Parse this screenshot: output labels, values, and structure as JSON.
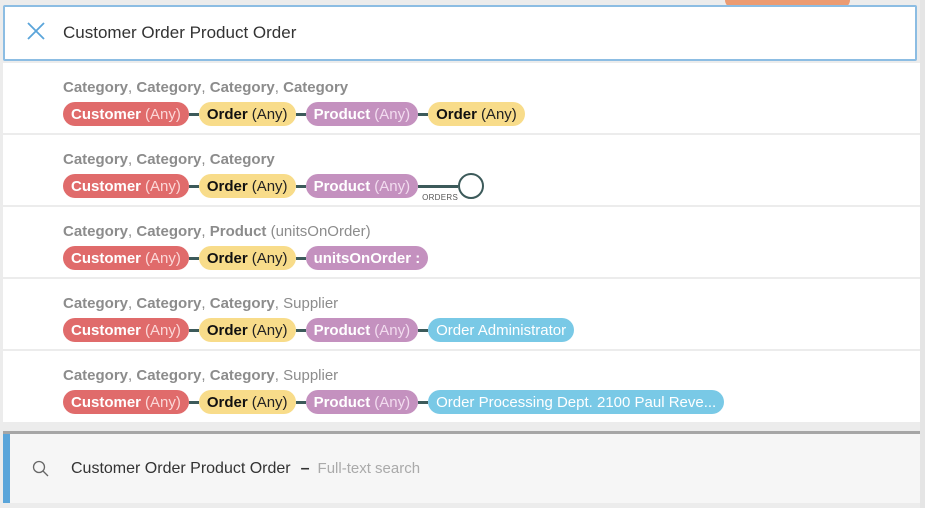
{
  "search": {
    "query": "Customer Order Product Order",
    "clear_icon": "close-icon"
  },
  "colors": {
    "customer": "#e06b6b",
    "order": "#f8dc8a",
    "product": "#c491bf",
    "supplier": "#79c9e6",
    "accent": "#5aa5da",
    "connector": "#3c5a5a"
  },
  "results": [
    {
      "categories": [
        {
          "name": "Category",
          "attr": ""
        },
        {
          "name": "Category",
          "attr": ""
        },
        {
          "name": "Category",
          "attr": ""
        },
        {
          "name": "Category",
          "attr": ""
        }
      ],
      "pills": [
        {
          "type": "customer",
          "label": "Customer",
          "sub": "(Any)"
        },
        {
          "type": "order",
          "label": "Order",
          "sub": "(Any)"
        },
        {
          "type": "product",
          "label": "Product",
          "sub": "(Any)"
        },
        {
          "type": "order",
          "label": "Order",
          "sub": "(Any)"
        }
      ]
    },
    {
      "categories": [
        {
          "name": "Category",
          "attr": ""
        },
        {
          "name": "Category",
          "attr": ""
        },
        {
          "name": "Category",
          "attr": ""
        }
      ],
      "pills": [
        {
          "type": "customer",
          "label": "Customer",
          "sub": "(Any)"
        },
        {
          "type": "order",
          "label": "Order",
          "sub": "(Any)"
        },
        {
          "type": "product",
          "label": "Product",
          "sub": "(Any)"
        }
      ],
      "relation_label": "ORDERS"
    },
    {
      "categories": [
        {
          "name": "Category",
          "attr": ""
        },
        {
          "name": "Category",
          "attr": ""
        },
        {
          "name": "Product",
          "attr": "(unitsOnOrder)"
        }
      ],
      "pills": [
        {
          "type": "customer",
          "label": "Customer",
          "sub": "(Any)"
        },
        {
          "type": "order",
          "label": "Order",
          "sub": "(Any)"
        },
        {
          "type": "product",
          "label": "unitsOnOrder :",
          "sub": ""
        }
      ]
    },
    {
      "categories": [
        {
          "name": "Category",
          "attr": ""
        },
        {
          "name": "Category",
          "attr": ""
        },
        {
          "name": "Category",
          "attr": ""
        },
        {
          "name": "",
          "attr": "Supplier"
        }
      ],
      "pills": [
        {
          "type": "customer",
          "label": "Customer",
          "sub": "(Any)"
        },
        {
          "type": "order",
          "label": "Order",
          "sub": "(Any)"
        },
        {
          "type": "product",
          "label": "Product",
          "sub": "(Any)"
        },
        {
          "type": "supplier",
          "label": "",
          "sub": "Order Administrator"
        }
      ]
    },
    {
      "categories": [
        {
          "name": "Category",
          "attr": ""
        },
        {
          "name": "Category",
          "attr": ""
        },
        {
          "name": "Category",
          "attr": ""
        },
        {
          "name": "",
          "attr": "Supplier"
        }
      ],
      "pills": [
        {
          "type": "customer",
          "label": "Customer",
          "sub": "(Any)"
        },
        {
          "type": "order",
          "label": "Order",
          "sub": "(Any)"
        },
        {
          "type": "product",
          "label": "Product",
          "sub": "(Any)"
        },
        {
          "type": "supplier",
          "label": "",
          "sub": "Order Processing Dept. 2100 Paul Reve..."
        }
      ]
    }
  ],
  "fulltext": {
    "query": "Customer Order Product Order",
    "dash": "–",
    "label": "Full-text search",
    "icon": "search-icon"
  }
}
